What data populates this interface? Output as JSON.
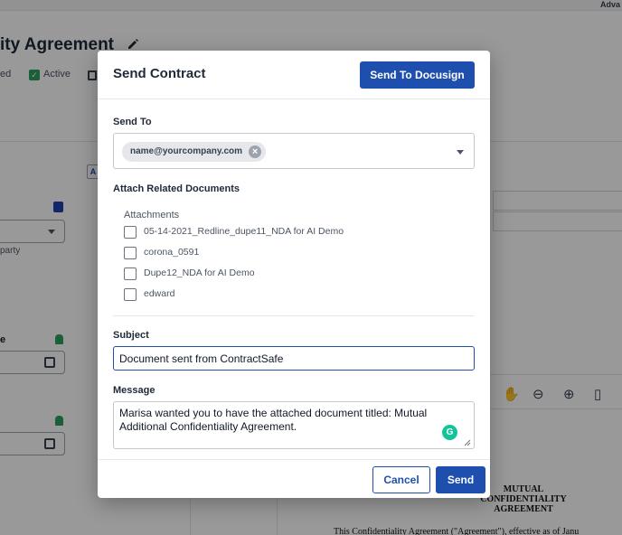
{
  "background": {
    "topbar_text": "Adva",
    "page_title": "ity Agreement",
    "status_left": "ed",
    "status_active": "Active",
    "action_button": "A",
    "party_label": "party",
    "date_label": "e",
    "document": {
      "title_line1": "MUTUAL",
      "title_line2": "CONFIDENTIALITY AGREEMENT",
      "body_line": "This Confidentiality Agreement (\"Agreement\"), effective as of Janu"
    }
  },
  "modal": {
    "title": "Send Contract",
    "docusign_button": "Send To Docusign",
    "send_to": {
      "label": "Send To",
      "recipients": [
        "name@yourcompany.com"
      ]
    },
    "attach": {
      "label": "Attach Related Documents",
      "attachments_title": "Attachments",
      "items": [
        {
          "name": "05-14-2021_Redline_dupe11_NDA for AI Demo",
          "checked": false
        },
        {
          "name": "corona_0591",
          "checked": false
        },
        {
          "name": "Dupe12_NDA for AI Demo",
          "checked": false
        },
        {
          "name": "edward",
          "checked": false
        }
      ]
    },
    "subject": {
      "label": "Subject",
      "value": "Document sent from ContractSafe"
    },
    "message": {
      "label": "Message",
      "value": "Marisa wanted you to have the attached document titled: Mutual Additional Confidentiality Agreement."
    },
    "cancel_button": "Cancel",
    "send_button": "Send"
  },
  "colors": {
    "primary": "#1e4fae",
    "overlay": "rgba(0,0,0,0.40)",
    "active_green": "#2e9e5e",
    "grammarly": "#15c39a"
  }
}
